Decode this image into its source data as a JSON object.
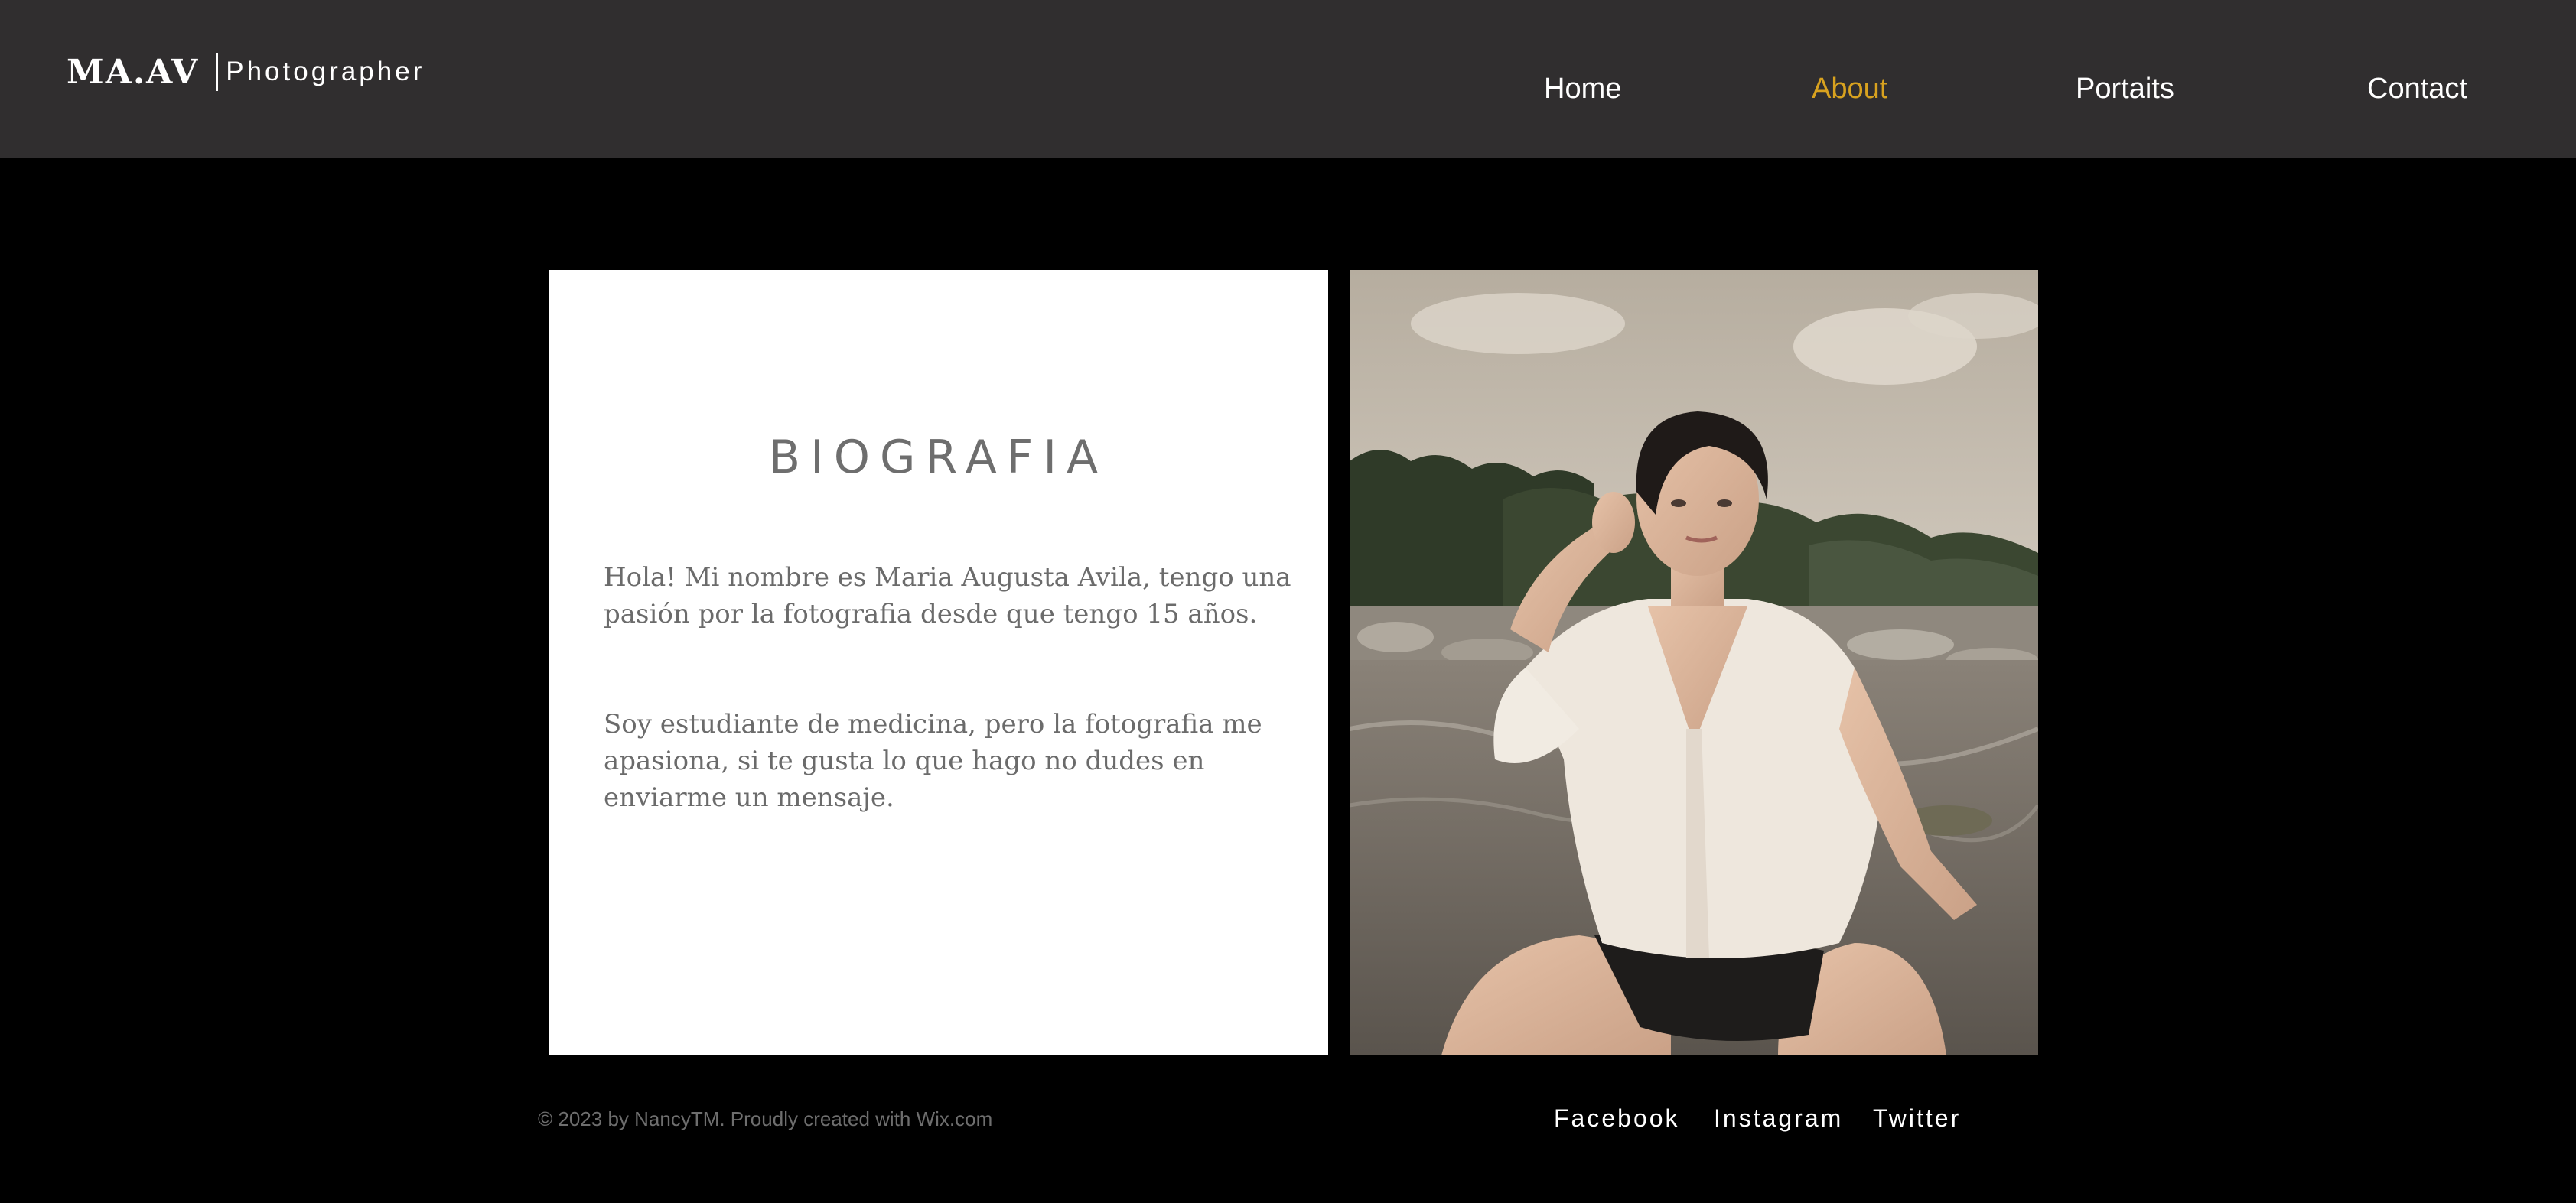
{
  "header": {
    "brand_name": "MA.AV",
    "brand_tagline": "Photographer",
    "nav": [
      {
        "label": "Home",
        "active": false
      },
      {
        "label": "About",
        "active": true
      },
      {
        "label": "Portaits",
        "active": false
      },
      {
        "label": "Contact",
        "active": false
      }
    ]
  },
  "bio": {
    "title": "BIOGRAFIA",
    "paragraphs": [
      "Hola! Mi nombre es Maria Augusta Avila, tengo una pasión por la fotografia desde que tengo 15 años.",
      "Soy estudiante de medicina, pero la fotografia me apasiona, si te gusta lo que hago no dudes en enviarme un mensaje."
    ]
  },
  "footer": {
    "copyright": "© 2023 by NancyTM. Proudly created with Wix.com",
    "social": [
      "Facebook",
      "Instagram",
      "Twitter"
    ]
  },
  "colors": {
    "header_bg": "#302e2f",
    "page_bg": "#000000",
    "accent": "#d8a21f",
    "body_text": "#6b6b6b"
  }
}
